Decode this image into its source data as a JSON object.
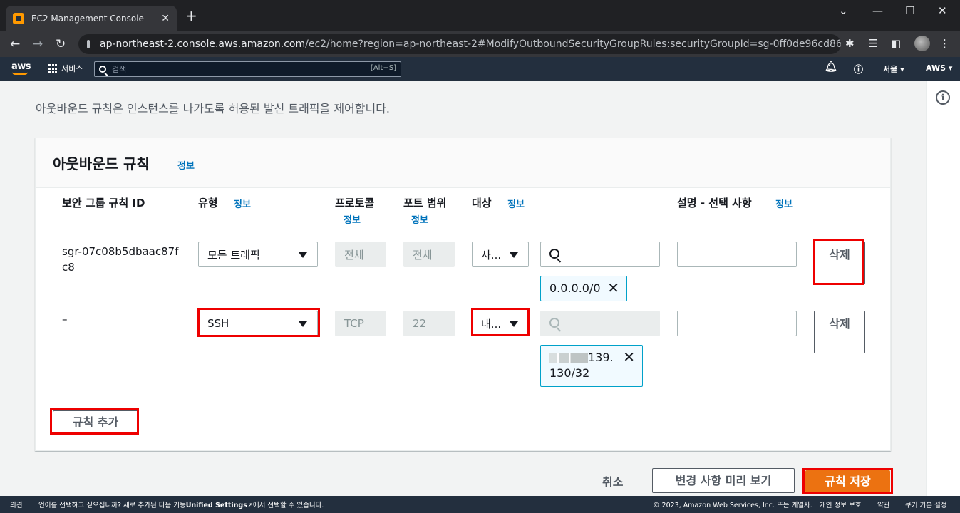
{
  "browser": {
    "tab_title": "EC2 Management Console",
    "url_host": "ap-northeast-2.console.aws.amazon.com",
    "url_path": "/ec2/home?region=ap-northeast-2#ModifyOutboundSecurityGroupRules:securityGroupId=sg-0ff0de96cd86..."
  },
  "awsnav": {
    "logo": "aws",
    "services_label": "서비스",
    "search_placeholder": "검색",
    "search_shortcut": "[Alt+S]",
    "region": "서울 ▾",
    "account": "AWS ▾"
  },
  "page": {
    "description": "아웃바운드 규칙은 인스턴스를 나가도록 허용된 발신 트래픽을 제어합니다."
  },
  "card": {
    "title": "아웃바운드 규칙",
    "info": "정보",
    "columns": {
      "rule_id": "보안 그룹 규칙 ID",
      "type": "유형",
      "protocol": "프로토콜",
      "port_range": "포트 범위",
      "destination": "대상",
      "description": "설명 - 선택 사항",
      "info": "정보"
    },
    "rows": [
      {
        "rule_id": "sgr-07c08b5dbaac87fc8",
        "type": "모든 트래픽",
        "protocol": "전체",
        "port": "전체",
        "dest_type": "사...",
        "token": "0.0.0.0/0",
        "delete": "삭제"
      },
      {
        "rule_id": "–",
        "type": "SSH",
        "protocol": "TCP",
        "port": "22",
        "dest_type": "내...",
        "token_visible": "139.",
        "token_line2": "130/32",
        "delete": "삭제"
      }
    ],
    "add_rule": "규칙 추가"
  },
  "actions": {
    "cancel": "취소",
    "preview": "변경 사항 미리 보기",
    "save": "규칙 저장"
  },
  "bottombar": {
    "feedback": "의견",
    "language_prefix": "언어를 선택하고 싶으십니까? 새로 추가된 다음 기능",
    "unified": "Unified Settings",
    "language_suffix": "에서 선택할 수 있습니다.",
    "copyright": "© 2023, Amazon Web Services, Inc. 또는 계열사.",
    "privacy": "개인 정보 보호",
    "terms": "약관",
    "cookies": "쿠키 기본 설정"
  },
  "colors": {
    "accent": "#0073bb",
    "save": "#ec7211",
    "highlight": "#ee0000"
  }
}
